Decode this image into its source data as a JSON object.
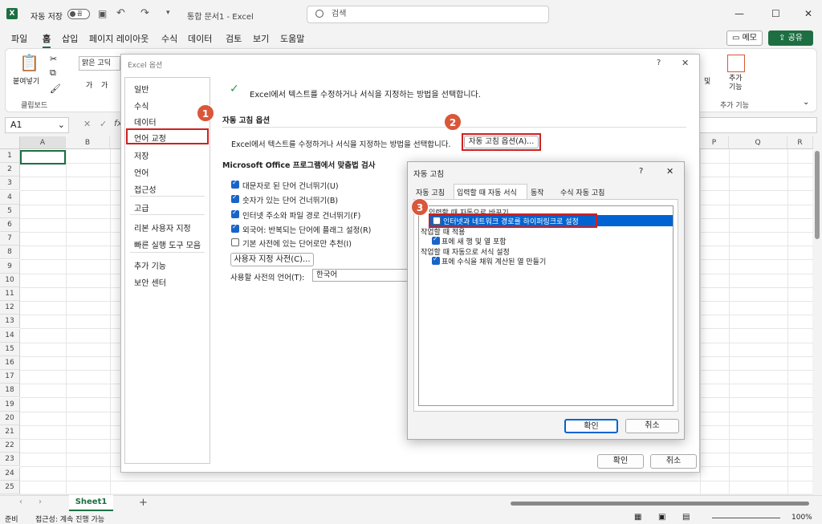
{
  "titlebar": {
    "autosave_label": "자동 저장",
    "toggle_state": "끔",
    "doc_title": "통합 문서1 - Excel",
    "search_placeholder": "검색"
  },
  "menu": {
    "items": [
      "파일",
      "홈",
      "삽입",
      "페이지 레이아웃",
      "수식",
      "데이터",
      "검토",
      "보기",
      "도움말"
    ],
    "active": "홈",
    "memo": "메모",
    "share": "공유"
  },
  "ribbon": {
    "paste": "붙여넣기",
    "clipboard_group": "클립보드",
    "font_name": "맑은 고딕",
    "find": "및",
    "addins": "추가\n기능",
    "addins_group": "추가 기능"
  },
  "formula": {
    "cell_ref": "A1",
    "fx": "fx"
  },
  "grid": {
    "columns": [
      "A",
      "B",
      "P",
      "Q",
      "R"
    ],
    "rows": [
      "1",
      "2",
      "3",
      "4",
      "5",
      "6",
      "7",
      "8",
      "9",
      "10",
      "11",
      "12",
      "13",
      "14",
      "15",
      "16",
      "17",
      "18",
      "19",
      "20",
      "21",
      "22",
      "23",
      "24",
      "25"
    ]
  },
  "sheetbar": {
    "sheet_name": "Sheet1",
    "add": "+"
  },
  "statusbar": {
    "ready": "준비",
    "accessibility": "접근성: 계속 진행 가능",
    "zoom": "100%"
  },
  "options_dialog": {
    "title": "Excel 옵션",
    "nav": [
      "일반",
      "수식",
      "데이터",
      "언어 교정",
      "저장",
      "언어",
      "접근성",
      "고급",
      "리본 사용자 지정",
      "빠른 실행 도구 모음",
      "추가 기능",
      "보안 센터"
    ],
    "active_nav": "언어 교정",
    "header_text": "Excel에서 텍스트를 수정하거나 서식을 지정하는 방법을 선택합니다.",
    "autocorrect_section": "자동 고침 옵션",
    "autocorrect_desc": "Excel에서 텍스트를 수정하거나 서식을 지정하는 방법을 선택합니다.",
    "autocorrect_button": "자동 고침 옵션(A)...",
    "spelling_section": "Microsoft Office 프로그램에서 맞춤법 검사",
    "checks": [
      {
        "label": "대문자로 된 단어 건너뛰기(U)",
        "checked": true
      },
      {
        "label": "숫자가 있는 단어 건너뛰기(B)",
        "checked": true
      },
      {
        "label": "인터넷 주소와 파일 경로 건너뛰기(F)",
        "checked": true
      },
      {
        "label": "외국어: 반복되는 단어에 플래그 설정(R)",
        "checked": true
      },
      {
        "label": "기본 사전에 있는 단어로만 추천(I)",
        "checked": false
      }
    ],
    "custom_dict_button": "사용자 지정 사전(C)...",
    "dict_lang_label": "사용할 사전의 언어(T):",
    "dict_lang_value": "한국어",
    "ok": "확인",
    "cancel": "취소",
    "help": "?",
    "close": "✕"
  },
  "autocorrect_dialog": {
    "title": "자동 고침",
    "tabs": [
      "자동 고침",
      "입력할 때 자동 서식",
      "동작",
      "수식 자동 고침"
    ],
    "active_tab": "입력할 때 자동 서식",
    "group1": "입력할 때 자동으로 바꾸기",
    "item1": "인터넷과 네트워크 경로를 하이퍼링크로 설정",
    "group2": "작업할 때 적용",
    "item2": "표에 새 행 및 열 포함",
    "group3": "작업할 때 자동으로 서식 설정",
    "item3": "표에 수식을 채워 계산된 열 만들기",
    "ok": "확인",
    "cancel": "취소",
    "help": "?",
    "close": "✕"
  },
  "badges": [
    "1",
    "2",
    "3"
  ],
  "colors": {
    "excel_green": "#1d6f42",
    "highlight_red": "#d02020",
    "badge": "#d9573a",
    "select_blue": "#0063d1"
  }
}
